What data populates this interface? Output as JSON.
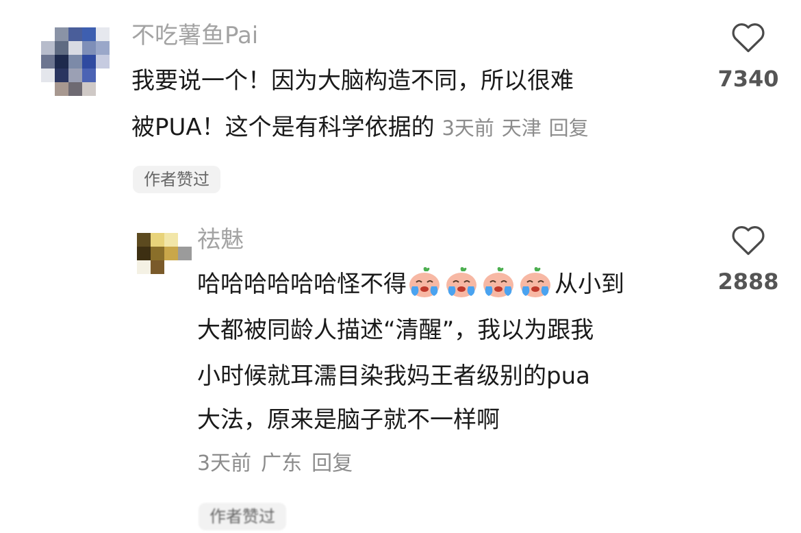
{
  "comments": [
    {
      "username": "不吃薯鱼Pai",
      "text_lines": [
        "我要说一个！因为大脑构造不同，所以很难",
        "被PUA！这个是有科学依据的"
      ],
      "time": "3天前",
      "location": "天津",
      "reply_label": "回复",
      "tag": "作者赞过",
      "likes": "7340"
    },
    {
      "username": "祛魅",
      "text_lines": [
        "哈哈哈哈哈哈怪不得",
        "从小到",
        "大都被同龄人描述“清醒”，我以为跟我",
        "小时候就耳濡目染我妈王者级别的pua",
        "大法，原来是脑子就不一样啊"
      ],
      "emoji": [
        "crying-peach-emoji",
        "crying-peach-emoji",
        "crying-peach-emoji",
        "crying-peach-emoji"
      ],
      "time": "3天前",
      "location": "广东",
      "reply_label": "回复",
      "tag": "作者赞过",
      "likes": "2888"
    }
  ],
  "icons": {
    "like": "heart-outline-icon"
  },
  "colors": {
    "username": "#a3a3a3",
    "body_text": "#1a1a1a",
    "meta": "#8c8c8c",
    "tag_bg": "#f2f2f2"
  }
}
